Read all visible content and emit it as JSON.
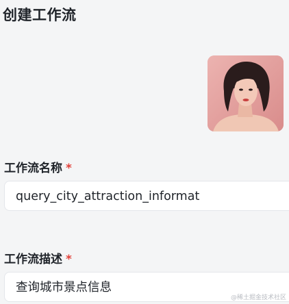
{
  "page": {
    "title": "创建工作流"
  },
  "avatar": {
    "icon": "avatar-photo"
  },
  "form": {
    "name_label": "工作流名称",
    "name_required": "*",
    "name_value": "query_city_attraction_informat",
    "desc_label": "工作流描述",
    "desc_required": "*",
    "desc_value": "查询城市景点信息"
  },
  "watermark": {
    "text": "@稀土掘金技术社区"
  },
  "colors": {
    "required": "#e2423b",
    "background": "#f4f5f6",
    "field_bg": "#ffffff"
  }
}
